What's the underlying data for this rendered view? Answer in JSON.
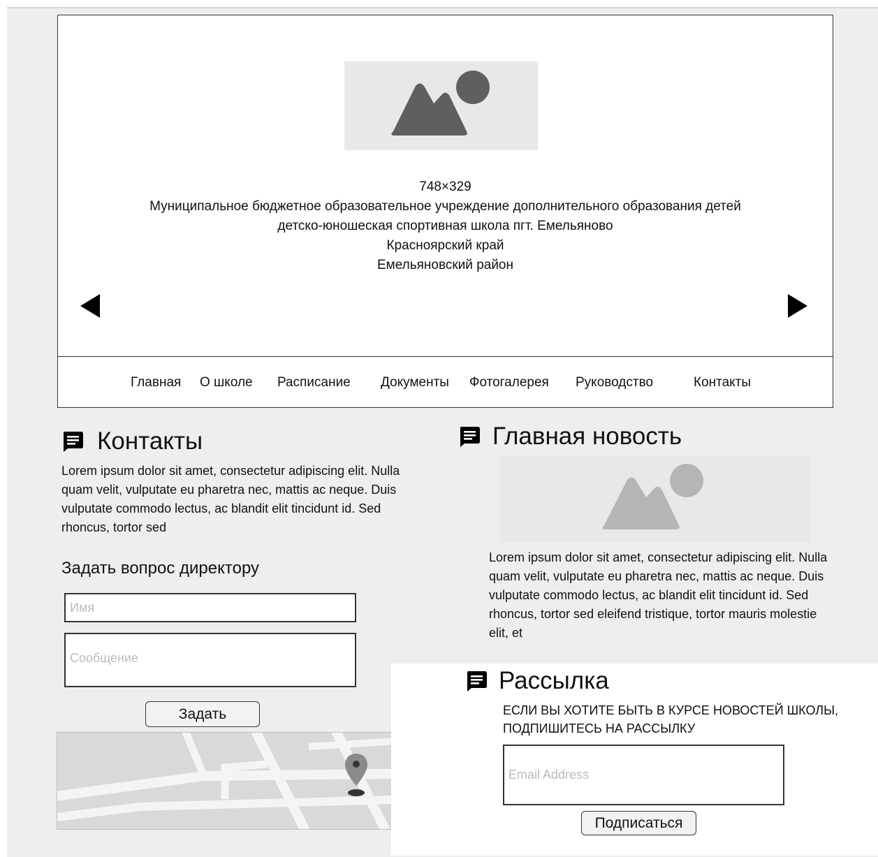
{
  "hero": {
    "image_size": "748×329",
    "lines": [
      "Муниципальное бюджетное образовательное учреждение дополнительного образования детей",
      "детско-юношеская спортивная школа пгт. Емельяново",
      "Красноярский край",
      "Емельяновский район"
    ]
  },
  "nav": {
    "items": [
      "Главная",
      "О школе",
      "Расписание",
      "Документы",
      "Фотогалерея",
      "Руководство",
      "Контакты"
    ]
  },
  "contacts": {
    "title": "Контакты",
    "lorem": "Lorem ipsum dolor sit amet, consectetur adipiscing elit. Nulla quam velit, vulputate eu pharetra nec, mattis ac neque. Duis vulputate commodo lectus, ac blandit elit tincidunt id. Sed rhoncus, tortor sed"
  },
  "question": {
    "title": "Задать вопрос директору",
    "name_placeholder": "Имя",
    "message_placeholder": "Сообщение",
    "submit_label": "Задать"
  },
  "news": {
    "title": "Главная новость",
    "lorem": "Lorem ipsum dolor sit amet, consectetur adipiscing elit. Nulla quam velit, vulputate eu pharetra nec, mattis ac neque. Duis vulputate commodo lectus, ac blandit elit tincidunt id. Sed rhoncus, tortor sed eleifend tristique, tortor mauris molestie elit, et"
  },
  "newsletter": {
    "title": "Рассылка",
    "text": "ЕСЛИ ВЫ ХОТИТЕ БЫТЬ В КУРСЕ НОВОСТЕЙ ШКОЛЫ, ПОДПИШИТЕСЬ НА РАССЫЛКУ",
    "email_placeholder": "Email Address",
    "subscribe_label": "Подписаться"
  },
  "icons": {
    "image_placeholder": "image-placeholder-icon",
    "message": "message-icon",
    "arrow_left": "arrow-left-icon",
    "arrow_right": "arrow-right-icon",
    "map_pin": "map-pin-icon"
  },
  "colors": {
    "page_bg": "#eeeeee",
    "panel_bg": "#ffffff",
    "border": "#333333",
    "placeholder_text": "#bbbbbb"
  }
}
